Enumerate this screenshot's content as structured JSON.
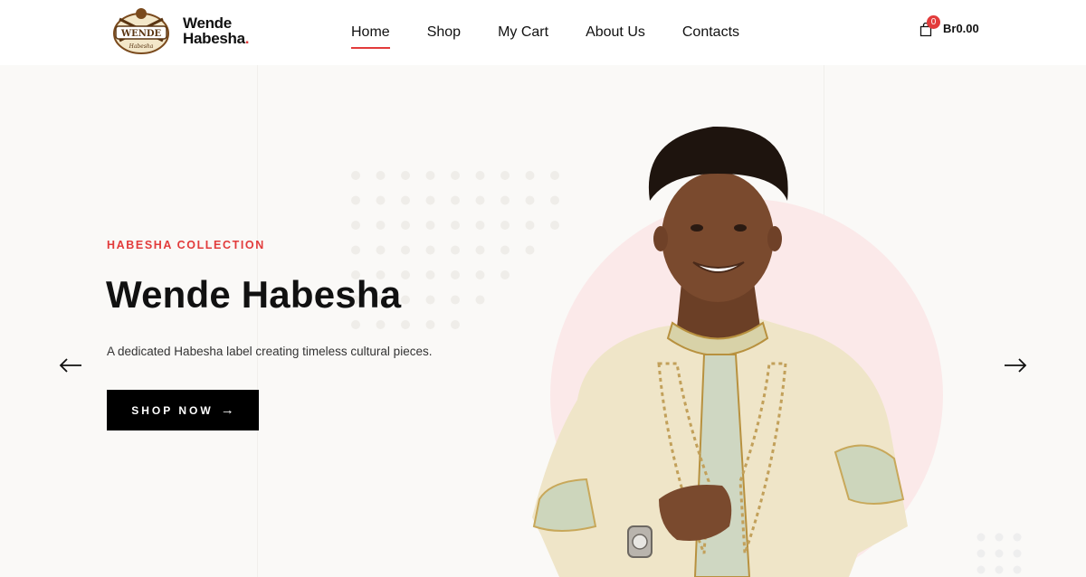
{
  "brand": {
    "name_line1": "Wende",
    "name_line2": "Habesha",
    "name_dot": ".",
    "badge_text": "WENDE",
    "accent_color": "#e23b3b"
  },
  "nav": {
    "items": [
      {
        "label": "Home",
        "active": true
      },
      {
        "label": "Shop",
        "active": false
      },
      {
        "label": "My Cart",
        "active": false
      },
      {
        "label": "About Us",
        "active": false
      },
      {
        "label": "Contacts",
        "active": false
      }
    ]
  },
  "cart": {
    "icon": "shopping-bag-icon",
    "count": "0",
    "total": "Br0.00"
  },
  "hero": {
    "tag": "HABESHA COLLECTION",
    "title": "Wende Habesha",
    "subtitle": "A dedicated Habesha label creating timeless cultural pieces.",
    "cta_label": "SHOP NOW",
    "cta_icon": "arrow-right-icon",
    "prev_icon": "arrow-left-icon",
    "next_icon": "arrow-right-icon",
    "background_color": "#faf9f7",
    "circle_color": "#fbe9e9"
  }
}
